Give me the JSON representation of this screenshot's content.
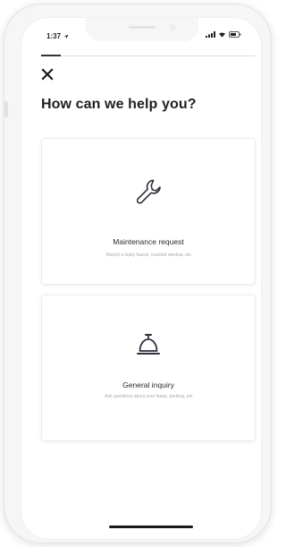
{
  "status_bar": {
    "time": "1:37",
    "location_icon": "location-arrow-icon",
    "signal_icon": "cell-signal-icon",
    "wifi_icon": "wifi-icon",
    "battery_icon": "battery-icon"
  },
  "header": {
    "close_icon": "close-icon",
    "title": "How can we help you?"
  },
  "options": [
    {
      "icon": "wrench-icon",
      "label": "Maintenance request",
      "description": "Report a leaky faucet, cracked window, etc."
    },
    {
      "icon": "service-bell-icon",
      "label": "General inquiry",
      "description": "Ask questions about your lease, parking, etc."
    }
  ],
  "colors": {
    "text_primary": "#1f1f1f",
    "text_secondary": "#a9a9a9",
    "card_border": "#ececec",
    "icon_stroke": "#2d2f3a"
  }
}
